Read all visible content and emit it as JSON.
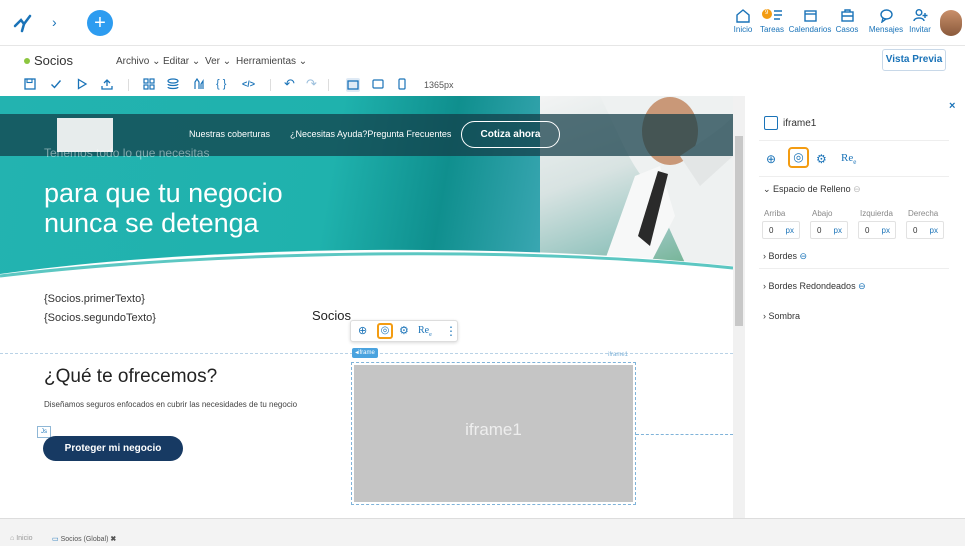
{
  "topbar": {
    "items": [
      {
        "label": "Inicio",
        "icon": "home-icon"
      },
      {
        "label": "Tareas",
        "icon": "tasks-icon",
        "badge": "9"
      },
      {
        "label": "Calendarios",
        "icon": "calendar-icon"
      },
      {
        "label": "Casos",
        "icon": "briefcase-icon"
      },
      {
        "label": "Mensajes",
        "icon": "chat-icon"
      },
      {
        "label": "Invitar",
        "icon": "add-user-icon"
      }
    ],
    "accent": "#1a73b8"
  },
  "page": {
    "title": "Socios",
    "menus": [
      "Archivo",
      "Editar",
      "Ver",
      "Herramientas"
    ],
    "preview_button": "Vista Previa",
    "width_readout": "1365px"
  },
  "canvas": {
    "nav_links": [
      "Nuestras coberturas",
      "¿Necesitas Ayuda?Pregunta Frecuentes"
    ],
    "nav_cta": "Cotiza ahora",
    "hero_small": "Tenemos todo lo que necesitas",
    "hero_line1": "para que tu negocio",
    "hero_line2": "nunca se detenga",
    "var1": "{Socios.primerTexto}",
    "var2": "{Socios.segundoTexto}",
    "socios_label": "Socios",
    "section_title": "¿Qué te ofrecemos?",
    "section_text": "Diseñamos seguros enfocados en cubrir las necesidades de tu negocio",
    "cta_button": "Proteger mi negocio",
    "iframe_tag": "iframe",
    "iframe_corner": "iframe1",
    "iframe_label": "iframe1",
    "js_badge": "Js",
    "float_tool_re": "Re"
  },
  "panel": {
    "title": "iframe1",
    "tool_re": "Re",
    "section_padding": "Espacio de Relleno",
    "padding_fields": [
      {
        "label": "Arriba",
        "value": "0",
        "unit": "px"
      },
      {
        "label": "Abajo",
        "value": "0",
        "unit": "px"
      },
      {
        "label": "Izquierda",
        "value": "0",
        "unit": "px"
      },
      {
        "label": "Derecha",
        "value": "0",
        "unit": "px"
      }
    ],
    "sections": [
      "Bordes",
      "Bordes Redondeados",
      "Sombra"
    ]
  },
  "footer": {
    "tabs": [
      "Inicio",
      "Socios (Global)"
    ]
  }
}
